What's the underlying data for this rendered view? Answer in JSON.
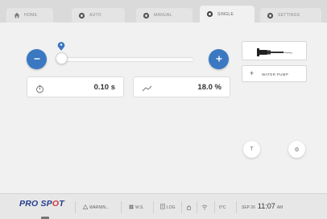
{
  "tabs": [
    {
      "label": "HOME",
      "icon": "home-icon"
    },
    {
      "label": "AUTO",
      "icon": "gear-icon"
    },
    {
      "label": "MANUAL",
      "icon": "gear-icon"
    },
    {
      "label": "SINGLE",
      "icon": "gear-icon",
      "active": true
    },
    {
      "label": "SETTINGS",
      "icon": "gear-icon"
    }
  ],
  "slider": {
    "level": 0.0
  },
  "values": {
    "time": "0.10 s",
    "power": "18.0 %"
  },
  "tool": {
    "icon": "welding-gun-icon"
  },
  "water_pump": {
    "label": "WATER PUMP",
    "icon": "plus-icon"
  },
  "action_buttons": {
    "left": "T",
    "right": "⚙"
  },
  "status_bar": {
    "logo_main": "PRO SP",
    "logo_accent": "O",
    "logo_end": "T",
    "items": [
      {
        "label": "WARNIN..."
      },
      {
        "label": "W.S."
      },
      {
        "label": "LOG"
      }
    ],
    "temp": "0°C",
    "date": "SEP 26",
    "time": "11:07",
    "ampm": "AM"
  },
  "colors": {
    "accent": "#3a78c2",
    "logo_blue": "#243d8f",
    "logo_red": "#d23a3a"
  }
}
